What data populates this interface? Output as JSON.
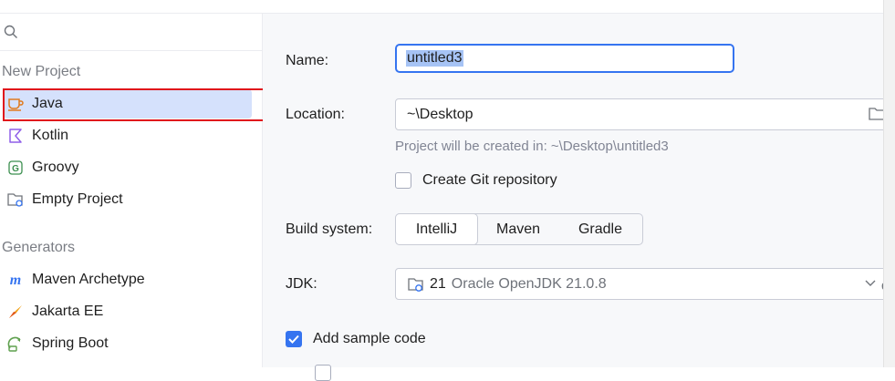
{
  "sidebar": {
    "search": {
      "placeholder": ""
    },
    "groups": [
      {
        "title": "New Project"
      },
      {
        "title": "Generators"
      }
    ],
    "items": [
      {
        "label": "Java"
      },
      {
        "label": "Kotlin"
      },
      {
        "label": "Groovy"
      },
      {
        "label": "Empty Project"
      },
      {
        "label": "Maven Archetype"
      },
      {
        "label": "Jakarta EE"
      },
      {
        "label": "Spring Boot"
      }
    ]
  },
  "form": {
    "name": {
      "label": "Name:",
      "value": "untitled3"
    },
    "location": {
      "label": "Location:",
      "value": "~\\Desktop",
      "hint": "Project will be created in: ~\\Desktop\\untitled3"
    },
    "git": {
      "label": "Create Git repository",
      "checked": false
    },
    "build": {
      "label": "Build system:",
      "options": [
        "IntelliJ",
        "Maven",
        "Gradle"
      ],
      "selected": "IntelliJ"
    },
    "jdk": {
      "label": "JDK:",
      "version": "21",
      "name": "Oracle OpenJDK 21.0.8"
    },
    "sample": {
      "label": "Add sample code",
      "checked": true
    },
    "clipped_text": "dv"
  },
  "colors": {
    "accent": "#3574f0",
    "selection": "#d5e1fc",
    "highlight_border": "#e0141c"
  }
}
